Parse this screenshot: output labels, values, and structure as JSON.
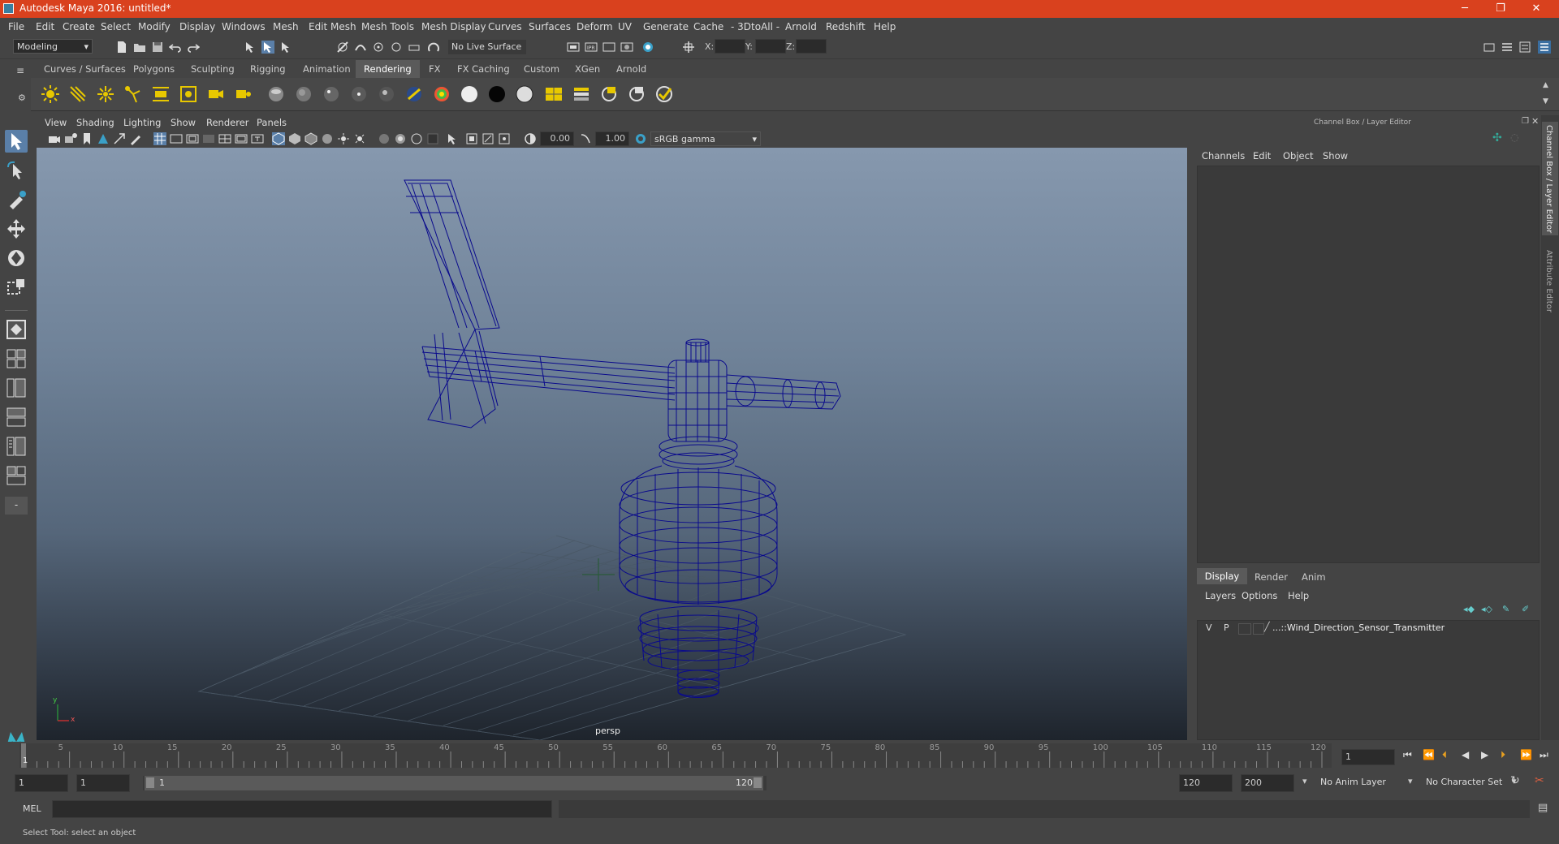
{
  "window": {
    "title": "Autodesk Maya 2016: untitled*",
    "min": "─",
    "max": "❐",
    "close": "✕"
  },
  "menu": [
    "File",
    "Edit",
    "Create",
    "Select",
    "Modify",
    "Display",
    "Windows",
    "Mesh",
    "Edit Mesh",
    "Mesh Tools",
    "Mesh Display",
    "Curves",
    "Surfaces",
    "Deform",
    "UV",
    "Generate",
    "Cache",
    "- 3DtoAll -",
    "Arnold",
    "Redshift",
    "Help"
  ],
  "status": {
    "mode": "Modeling",
    "live_surface": "No Live Surface",
    "x_label": "X:",
    "y_label": "Y:",
    "z_label": "Z:"
  },
  "shelf_tabs": [
    "Curves / Surfaces",
    "Polygons",
    "Sculpting",
    "Rigging",
    "Animation",
    "Rendering",
    "FX",
    "FX Caching",
    "Custom",
    "XGen",
    "Arnold"
  ],
  "shelf_active": "Rendering",
  "viewport": {
    "menu": [
      "View",
      "Shading",
      "Lighting",
      "Show",
      "Renderer",
      "Panels"
    ],
    "exposure": "0.00",
    "gamma": "1.00",
    "colorspace": "sRGB gamma",
    "camera": "persp",
    "axis_x": "x",
    "axis_y": "y"
  },
  "channel_box": {
    "title": "Channel Box / Layer Editor",
    "menu": [
      "Channels",
      "Edit",
      "Object",
      "Show"
    ]
  },
  "layer_editor": {
    "tabs": [
      "Display",
      "Render",
      "Anim"
    ],
    "active_tab": "Display",
    "menu": [
      "Layers",
      "Options",
      "Help"
    ],
    "layer": {
      "v": "V",
      "p": "P",
      "name": "...::Wind_Direction_Sensor_Transmitter"
    }
  },
  "side_tabs": [
    "Channel Box / Layer Editor",
    "Attribute Editor"
  ],
  "timeline": {
    "ticks": [
      "5",
      "10",
      "15",
      "20",
      "25",
      "30",
      "35",
      "40",
      "45",
      "50",
      "55",
      "60",
      "65",
      "70",
      "75",
      "80",
      "85",
      "90",
      "95",
      "100",
      "105",
      "110",
      "115",
      "120"
    ],
    "start_label": "1",
    "current_frame": "1"
  },
  "range": {
    "start": "1",
    "playback_start": "1",
    "slider_start": "1",
    "slider_end": "120",
    "playback_end": "120",
    "end": "200",
    "anim_layer": "No Anim Layer",
    "character_set": "No Character Set"
  },
  "command": {
    "label": "MEL"
  },
  "help": {
    "text": "Select Tool: select an object"
  },
  "colors": {
    "title_bar": "#d9411e",
    "wireframe": "#0a0a8c",
    "accent_yellow": "#e8c800"
  }
}
